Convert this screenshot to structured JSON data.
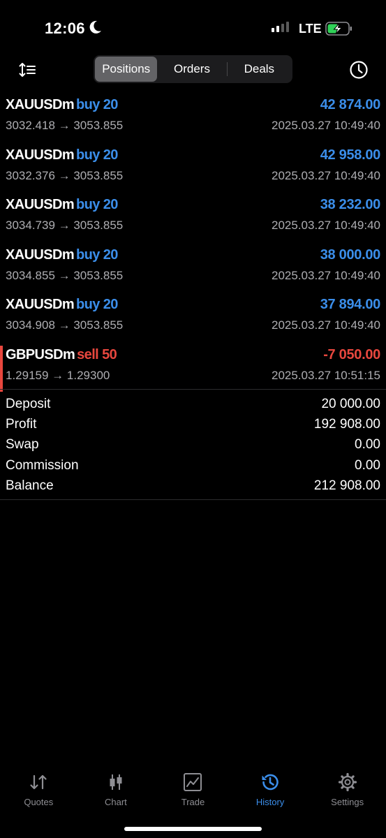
{
  "status_bar": {
    "time": "12:06",
    "network": "LTE"
  },
  "header": {
    "tabs": [
      {
        "label": "Positions",
        "active": true
      },
      {
        "label": "Orders",
        "active": false
      },
      {
        "label": "Deals",
        "active": false
      }
    ]
  },
  "positions": [
    {
      "symbol": "XAUUSDm",
      "side": "buy 20",
      "profit": "42 874.00",
      "prices": "3032.418 → 3053.855",
      "time": "2025.03.27 10:49:40"
    },
    {
      "symbol": "XAUUSDm",
      "side": "buy 20",
      "profit": "42 958.00",
      "prices": "3032.376 → 3053.855",
      "time": "2025.03.27 10:49:40"
    },
    {
      "symbol": "XAUUSDm",
      "side": "buy 20",
      "profit": "38 232.00",
      "prices": "3034.739 → 3053.855",
      "time": "2025.03.27 10:49:40"
    },
    {
      "symbol": "XAUUSDm",
      "side": "buy 20",
      "profit": "38 000.00",
      "prices": "3034.855 → 3053.855",
      "time": "2025.03.27 10:49:40"
    },
    {
      "symbol": "XAUUSDm",
      "side": "buy 20",
      "profit": "37 894.00",
      "prices": "3034.908 → 3053.855",
      "time": "2025.03.27 10:49:40"
    },
    {
      "symbol": "GBPUSDm",
      "side": "sell 50",
      "profit": "-7 050.00",
      "prices": "1.29159 → 1.29300",
      "time": "2025.03.27 10:51:15"
    }
  ],
  "summary": [
    {
      "label": "Deposit",
      "value": "20 000.00"
    },
    {
      "label": "Profit",
      "value": "192 908.00"
    },
    {
      "label": "Swap",
      "value": "0.00"
    },
    {
      "label": "Commission",
      "value": "0.00"
    },
    {
      "label": "Balance",
      "value": "212 908.00"
    }
  ],
  "tab_bar": [
    {
      "label": "Quotes",
      "icon": "quotes-icon"
    },
    {
      "label": "Chart",
      "icon": "chart-icon"
    },
    {
      "label": "Trade",
      "icon": "trade-icon"
    },
    {
      "label": "History",
      "icon": "history-icon",
      "active": true
    },
    {
      "label": "Settings",
      "icon": "settings-icon"
    }
  ],
  "colors": {
    "buy": "#3b8eea",
    "sell": "#e8473e",
    "accent": "#3b8eea"
  }
}
